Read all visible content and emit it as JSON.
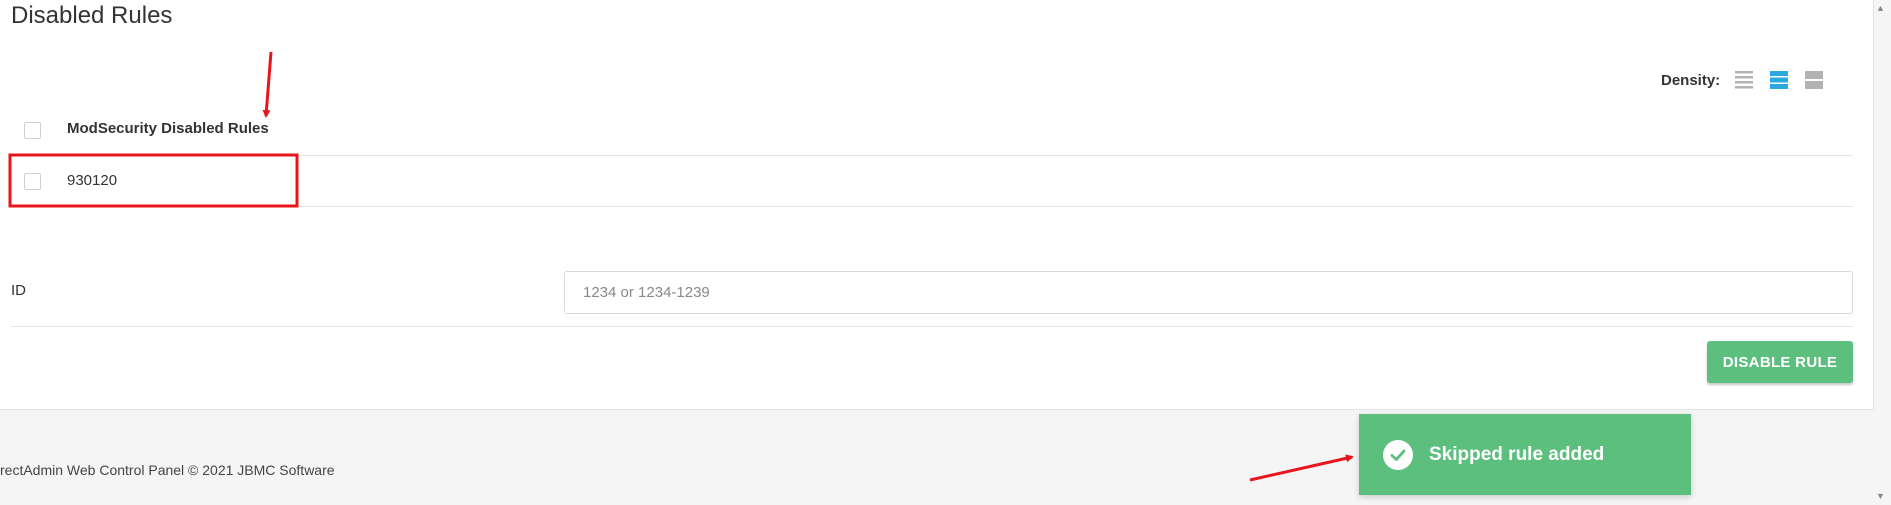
{
  "page": {
    "title": "Disabled Rules"
  },
  "density": {
    "label": "Density:",
    "options": [
      {
        "name": "compact",
        "active": false
      },
      {
        "name": "normal",
        "active": true
      },
      {
        "name": "comfortable",
        "active": false
      }
    ],
    "active_color": "#29a9e0",
    "inactive_color": "#b3b3b3"
  },
  "table": {
    "column_header": "ModSecurity Disabled Rules",
    "rows": [
      {
        "value": "930120"
      }
    ]
  },
  "form": {
    "id_label": "ID",
    "id_placeholder": "1234 or 1234-1239",
    "id_value": "",
    "submit_label": "DISABLE RULE"
  },
  "footer": {
    "text": "rectAdmin Web Control Panel © 2021 JBMC Software"
  },
  "toast": {
    "message": "Skipped rule added",
    "color": "#5cbf7e"
  },
  "annotation_color": "#e8151b"
}
